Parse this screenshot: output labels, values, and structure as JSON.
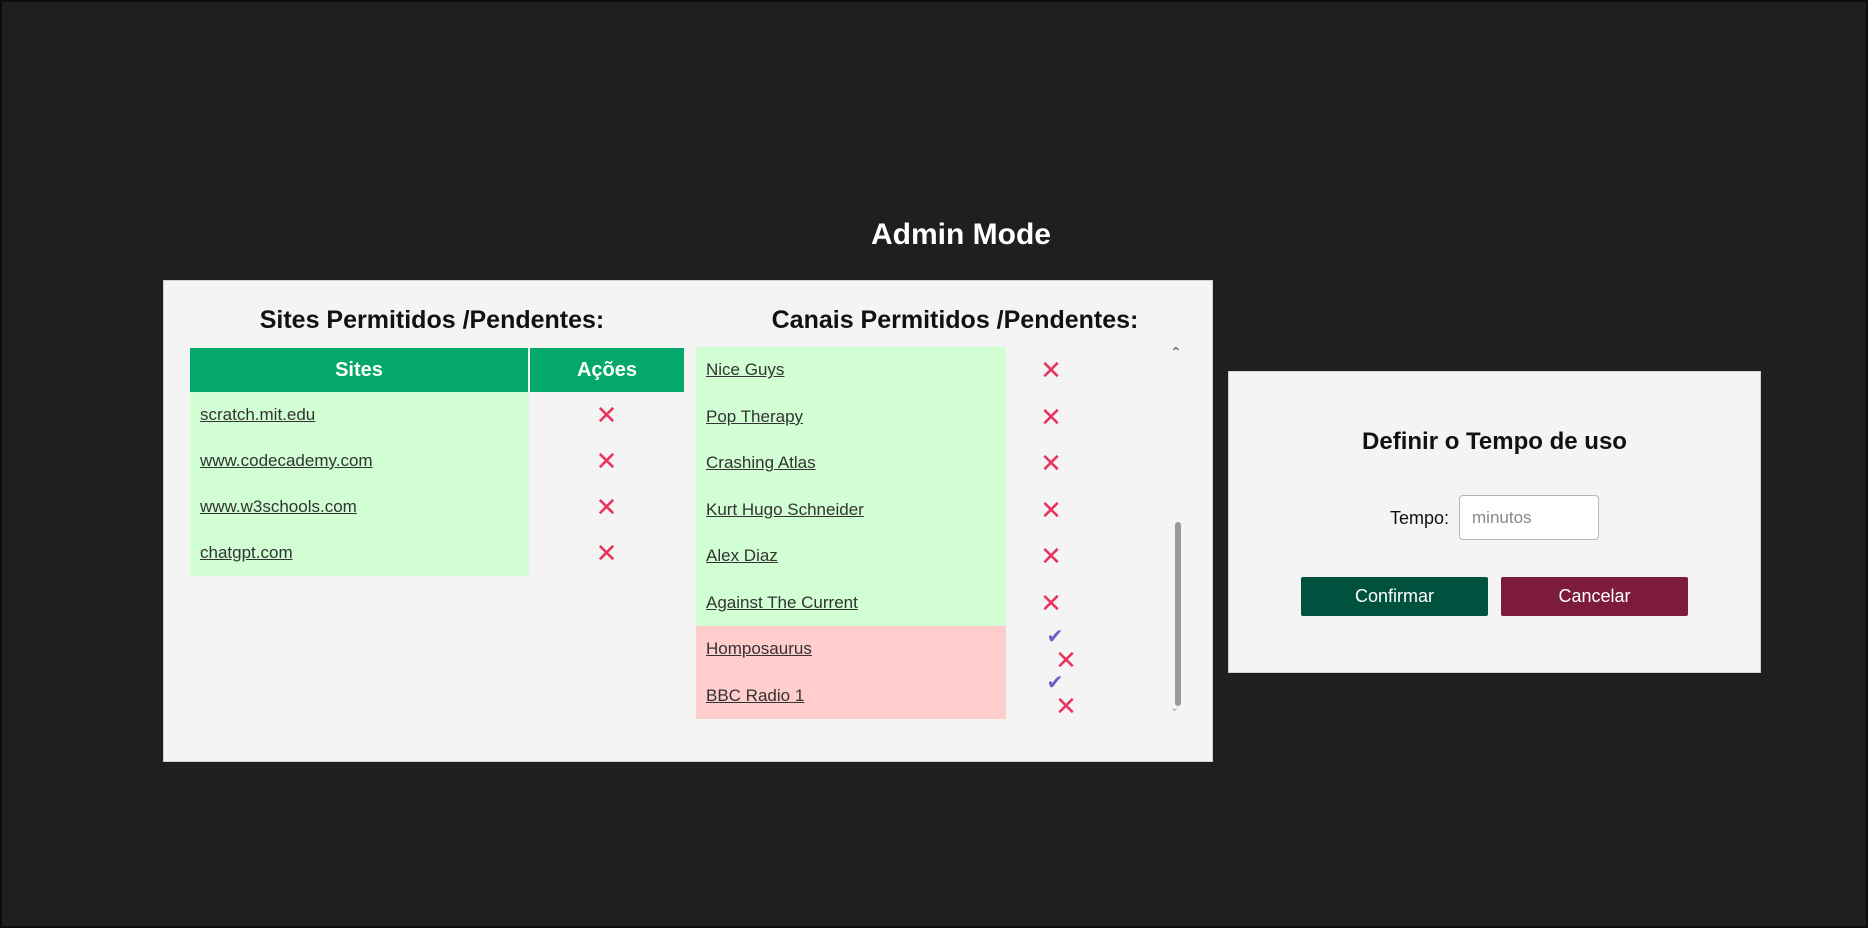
{
  "page": {
    "title": "Admin Mode"
  },
  "sites_section": {
    "title": "Sites Permitidos /Pendentes:",
    "headers": {
      "sites": "Sites",
      "actions": "Ações"
    },
    "rows": [
      {
        "site": "scratch.mit.edu",
        "status": "allowed"
      },
      {
        "site": "www.codecademy.com",
        "status": "allowed"
      },
      {
        "site": "www.w3schools.com",
        "status": "allowed"
      },
      {
        "site": "chatgpt.com",
        "status": "allowed"
      }
    ]
  },
  "channels_section": {
    "title": "Canais Permitidos /Pendentes:",
    "rows": [
      {
        "name": "Nice Guys",
        "status": "allowed"
      },
      {
        "name": "Pop Therapy",
        "status": "allowed"
      },
      {
        "name": "Crashing Atlas",
        "status": "allowed"
      },
      {
        "name": "Kurt Hugo Schneider",
        "status": "allowed"
      },
      {
        "name": "Alex Diaz",
        "status": "allowed"
      },
      {
        "name": "Against The Current",
        "status": "allowed"
      },
      {
        "name": "Homposaurus",
        "status": "pending"
      },
      {
        "name": "BBC Radio 1",
        "status": "pending"
      }
    ]
  },
  "icons": {
    "remove": "✕",
    "approve": "✔",
    "scroll_up": "⌃",
    "scroll_down": "⌄"
  },
  "time_panel": {
    "title": "Definir o Tempo de uso",
    "tempo_label": "Tempo:",
    "tempo_placeholder": "minutos",
    "tempo_value": "",
    "confirm_label": "Confirmar",
    "cancel_label": "Cancelar"
  },
  "colors": {
    "background": "#1f1f1f",
    "header_green": "#04a86a",
    "allowed_row": "#d1ffd3",
    "pending_row": "#ffcdcc",
    "remove_icon": "#e8335e",
    "approve_icon": "#6f5cc4",
    "confirm_button": "#00523f",
    "cancel_button": "#7d1b3a"
  }
}
